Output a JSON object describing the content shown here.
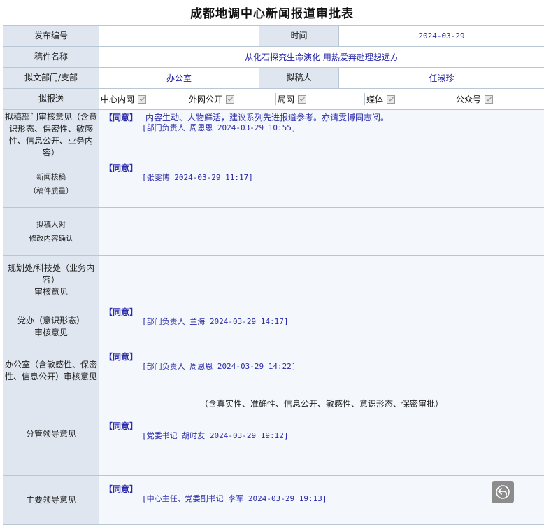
{
  "form": {
    "title": "成都地调中心新闻报道审批表",
    "fields": {
      "publish_no_label": "发布编号",
      "publish_no_value": "",
      "time_label": "时间",
      "time_value": "2024-03-29",
      "manuscript_label": "稿件名称",
      "manuscript_value": "从化石探究生命演化 用热爱奔赴理想远方",
      "dept_label": "拟文部门/支部",
      "dept_value": "办公室",
      "drafter_label": "拟稿人",
      "drafter_value": "任淑珍",
      "distribution_label": "拟报送"
    },
    "distribution": [
      {
        "label": "中心内网",
        "checked": true
      },
      {
        "label": "外网公开",
        "checked": true
      },
      {
        "label": "局网",
        "checked": true
      },
      {
        "label": "媒体",
        "checked": true
      },
      {
        "label": "公众号",
        "checked": true
      }
    ],
    "reviews": [
      {
        "label": "拟稿部门审核意见（含意识形态、保密性、敏感性、信息公开、业务内容）",
        "stamp": "【同意】",
        "opinion": "内容生动、人物鲜活，建议系列先进报道参考。亦请雯博同志阅。",
        "signature": "[部门负责人 周恩恩 2024-03-29 10:55]"
      },
      {
        "label_line1": "新闻核稿",
        "label_line2": "（稿件质量）",
        "stamp": "【同意】",
        "signature": "[张雯博 2024-03-29 11:17]"
      },
      {
        "label_line1": "拟稿人对",
        "label_line2": "修改内容确认"
      },
      {
        "label_line1": "规划处/科技处（业务内容）",
        "label_line2": "审核意见"
      },
      {
        "label_line1": "党办（意识形态）",
        "label_line2": "审核意见",
        "stamp": "【同意】",
        "signature": "[部门负责人 兰海 2024-03-29 14:17]"
      },
      {
        "label": "办公室（含敏感性、保密性、信息公开）审核意见",
        "stamp": "【同意】",
        "signature": "[部门负责人 周恩恩 2024-03-29 14:22]"
      },
      {
        "label": "分管领导意见",
        "scope": "（含真实性、准确性、信息公开、敏感性、意识形态、保密审批）",
        "stamp": "【同意】",
        "signature": "[党委书记 胡时友 2024-03-29 19:12]"
      },
      {
        "label": "主要领导意见",
        "stamp": "【同意】",
        "signature": "[中心主任、党委副书记 李军 2024-03-29 19:13]"
      }
    ]
  },
  "icons": {
    "checkbox": "checkmark",
    "reply": "reply-arrow-icon"
  }
}
